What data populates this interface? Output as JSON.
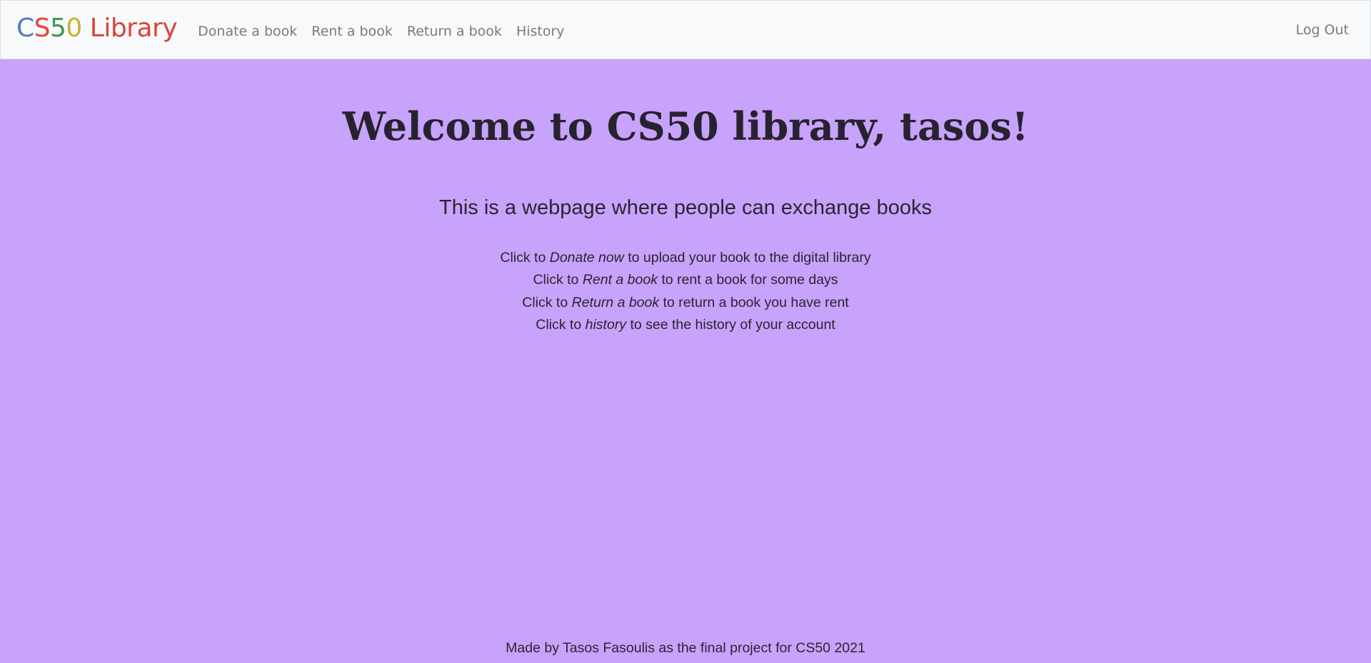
{
  "brand": {
    "letters": [
      {
        "char": "C",
        "color": "#537bc4"
      },
      {
        "char": "S",
        "color": "#ea433b"
      },
      {
        "char": "5",
        "color": "#3b9a4a"
      },
      {
        "char": "0",
        "color": "#c6b32c"
      },
      {
        "char": " Library",
        "color": "#d9453d"
      }
    ]
  },
  "nav": {
    "items": [
      {
        "label": "Donate a book"
      },
      {
        "label": "Rent a book"
      },
      {
        "label": "Return a book"
      },
      {
        "label": "History"
      }
    ],
    "logout_label": "Log Out"
  },
  "main": {
    "title": "Welcome to CS50 library, tasos!",
    "subtitle": "This is a webpage where people can exchange books",
    "instructions": [
      {
        "prefix": "Click to ",
        "emphasis": "Donate now",
        "suffix": " to upload your book to the digital library"
      },
      {
        "prefix": "Click to ",
        "emphasis": "Rent a book",
        "suffix": " to rent a book for some days"
      },
      {
        "prefix": "Click to ",
        "emphasis": "Return a book",
        "suffix": " to return a book you have rent"
      },
      {
        "prefix": "Click to ",
        "emphasis": "history",
        "suffix": " to see the history of your account"
      }
    ]
  },
  "footer": {
    "text": "Made by Tasos Fasoulis as the final project for CS50 2021"
  },
  "colors": {
    "background": "#c7a3fb",
    "navbar": "#f8f9fa",
    "nav_link": "#7a7a7a"
  }
}
